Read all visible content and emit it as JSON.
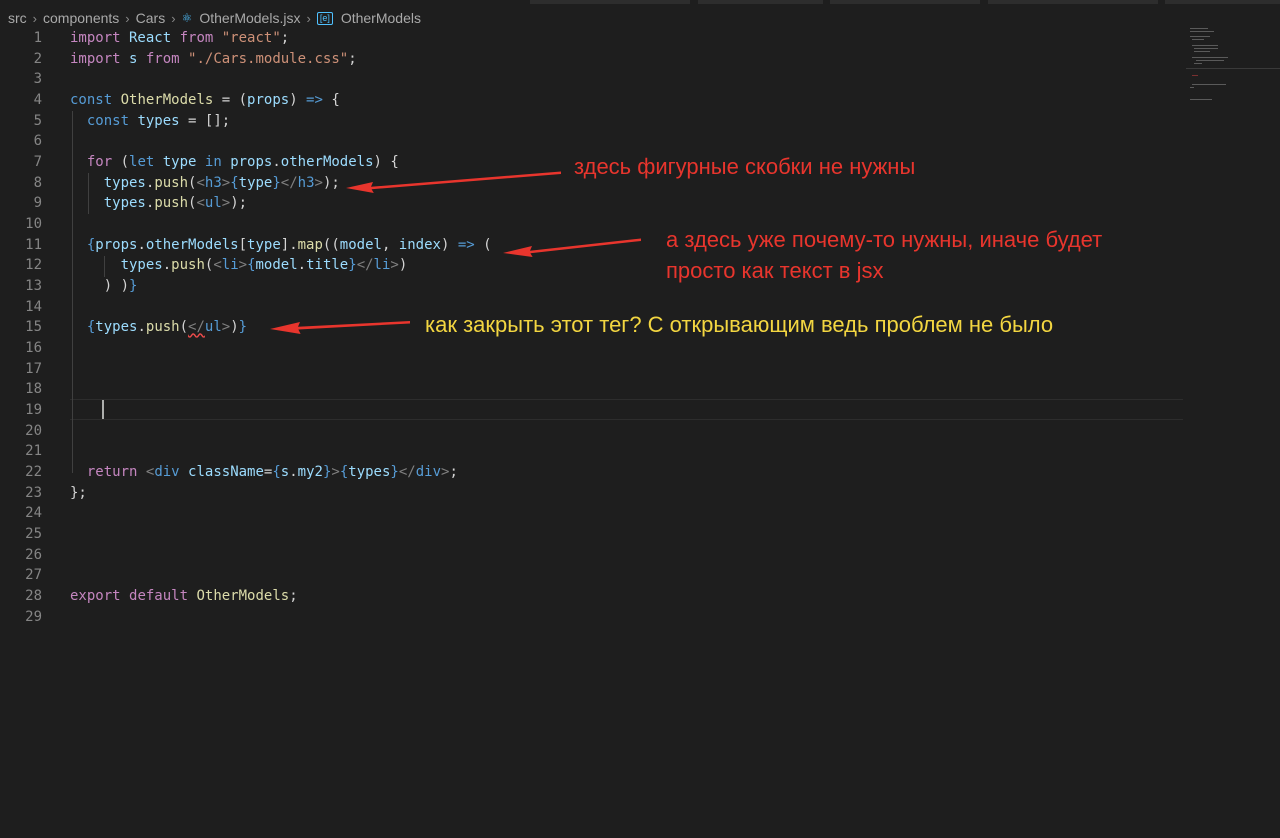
{
  "breadcrumb": {
    "items": [
      "src",
      "components",
      "Cars"
    ],
    "file": "OtherModels.jsx",
    "symbol": "OtherModels"
  },
  "editor": {
    "line_numbers": [
      "1",
      "2",
      "3",
      "4",
      "5",
      "6",
      "7",
      "8",
      "9",
      "10",
      "11",
      "12",
      "13",
      "14",
      "15",
      "16",
      "17",
      "18",
      "19",
      "20",
      "21",
      "22",
      "23",
      "24",
      "25",
      "26",
      "27",
      "28",
      "29"
    ],
    "lines": [
      [
        [
          "import",
          "ctl"
        ],
        [
          " React ",
          "var"
        ],
        [
          "from",
          "ctl"
        ],
        [
          " ",
          "pun"
        ],
        [
          "\"react\"",
          "str"
        ],
        [
          ";",
          "pun"
        ]
      ],
      [
        [
          "import",
          "ctl"
        ],
        [
          " s ",
          "var"
        ],
        [
          "from",
          "ctl"
        ],
        [
          " ",
          "pun"
        ],
        [
          "\"./Cars.module.css\"",
          "str"
        ],
        [
          ";",
          "pun"
        ]
      ],
      [],
      [
        [
          "const",
          "kw"
        ],
        [
          " ",
          "pun"
        ],
        [
          "OtherModels",
          "fn"
        ],
        [
          " = (",
          "pun"
        ],
        [
          "props",
          "var"
        ],
        [
          ") ",
          "pun"
        ],
        [
          "=>",
          "kw"
        ],
        [
          " {",
          "pun"
        ]
      ],
      [
        [
          "  ",
          "pun"
        ],
        [
          "const",
          "kw"
        ],
        [
          " ",
          "pun"
        ],
        [
          "types",
          "var"
        ],
        [
          " = [];",
          "pun"
        ]
      ],
      [],
      [
        [
          "  ",
          "pun"
        ],
        [
          "for",
          "ctl"
        ],
        [
          " (",
          "pun"
        ],
        [
          "let",
          "kw"
        ],
        [
          " ",
          "pun"
        ],
        [
          "type",
          "var"
        ],
        [
          " ",
          "pun"
        ],
        [
          "in",
          "kw"
        ],
        [
          " ",
          "pun"
        ],
        [
          "props",
          "var"
        ],
        [
          ".",
          "pun"
        ],
        [
          "otherModels",
          "var"
        ],
        [
          ") {",
          "pun"
        ]
      ],
      [
        [
          "    ",
          "pun"
        ],
        [
          "types",
          "var"
        ],
        [
          ".",
          "pun"
        ],
        [
          "push",
          "fn"
        ],
        [
          "(",
          "pun"
        ],
        [
          "<",
          "brk"
        ],
        [
          "h3",
          "tag"
        ],
        [
          ">",
          "brk"
        ],
        [
          "{",
          "kw"
        ],
        [
          "type",
          "var"
        ],
        [
          "}",
          "kw"
        ],
        [
          "</",
          "brk"
        ],
        [
          "h3",
          "tag"
        ],
        [
          ">",
          "brk"
        ],
        [
          ");",
          "pun"
        ]
      ],
      [
        [
          "    ",
          "pun"
        ],
        [
          "types",
          "var"
        ],
        [
          ".",
          "pun"
        ],
        [
          "push",
          "fn"
        ],
        [
          "(",
          "pun"
        ],
        [
          "<",
          "brk"
        ],
        [
          "ul",
          "tag"
        ],
        [
          ">",
          "brk"
        ],
        [
          ");",
          "pun"
        ]
      ],
      [],
      [
        [
          "  ",
          "pun"
        ],
        [
          "{",
          "kw"
        ],
        [
          "props",
          "var"
        ],
        [
          ".",
          "pun"
        ],
        [
          "otherModels",
          "var"
        ],
        [
          "[",
          "pun"
        ],
        [
          "type",
          "var"
        ],
        [
          "].",
          "pun"
        ],
        [
          "map",
          "fn"
        ],
        [
          "((",
          "pun"
        ],
        [
          "model",
          "var"
        ],
        [
          ", ",
          "pun"
        ],
        [
          "index",
          "var"
        ],
        [
          ") ",
          "pun"
        ],
        [
          "=>",
          "kw"
        ],
        [
          " (",
          "pun"
        ]
      ],
      [
        [
          "      ",
          "pun"
        ],
        [
          "types",
          "var"
        ],
        [
          ".",
          "pun"
        ],
        [
          "push",
          "fn"
        ],
        [
          "(",
          "pun"
        ],
        [
          "<",
          "brk"
        ],
        [
          "li",
          "tag"
        ],
        [
          ">",
          "brk"
        ],
        [
          "{",
          "kw"
        ],
        [
          "model",
          "var"
        ],
        [
          ".",
          "pun"
        ],
        [
          "title",
          "var"
        ],
        [
          "}",
          "kw"
        ],
        [
          "</",
          "brk"
        ],
        [
          "li",
          "tag"
        ],
        [
          ">",
          "brk"
        ],
        [
          ")",
          "pun"
        ]
      ],
      [
        [
          "    ",
          "pun"
        ],
        [
          ") )",
          "pun"
        ],
        [
          "}",
          "kw"
        ]
      ],
      [],
      [
        [
          "  ",
          "pun"
        ],
        [
          "{",
          "kw"
        ],
        [
          "types",
          "var"
        ],
        [
          ".",
          "pun"
        ],
        [
          "push",
          "fn"
        ],
        [
          "(",
          "pun"
        ],
        [
          "</",
          "brk squiggle"
        ],
        [
          "ul",
          "tag"
        ],
        [
          ">",
          "brk"
        ],
        [
          ")",
          "pun"
        ],
        [
          "}",
          "kw"
        ]
      ],
      [],
      [],
      [],
      [],
      [],
      [],
      [
        [
          "  ",
          "pun"
        ],
        [
          "return",
          "ctl"
        ],
        [
          " ",
          "pun"
        ],
        [
          "<",
          "brk"
        ],
        [
          "div",
          "tag"
        ],
        [
          " ",
          "pun"
        ],
        [
          "className",
          "var"
        ],
        [
          "=",
          "pun"
        ],
        [
          "{",
          "kw"
        ],
        [
          "s",
          "var"
        ],
        [
          ".",
          "pun"
        ],
        [
          "my2",
          "var"
        ],
        [
          "}",
          "kw"
        ],
        [
          ">",
          "brk"
        ],
        [
          "{",
          "kw"
        ],
        [
          "types",
          "var"
        ],
        [
          "}",
          "kw"
        ],
        [
          "</",
          "brk"
        ],
        [
          "div",
          "tag"
        ],
        [
          ">",
          "brk"
        ],
        [
          ";",
          "pun"
        ]
      ],
      [
        [
          "};",
          "pun"
        ]
      ],
      [],
      [],
      [],
      [],
      [
        [
          "export",
          "ctl"
        ],
        [
          " ",
          "pun"
        ],
        [
          "default",
          "ctl"
        ],
        [
          " ",
          "pun"
        ],
        [
          "OtherModels",
          "fn"
        ],
        [
          ";",
          "pun"
        ]
      ],
      []
    ]
  },
  "annotations": {
    "a1": "здесь фигурные скобки не нужны",
    "a2_line1": "а здесь уже почему-то нужны, иначе будет",
    "a2_line2": "просто как текст в jsx",
    "a3": "как закрыть этот тег? С открывающим ведь проблем не было"
  },
  "colors": {
    "background": "#1e1e1e",
    "annotation_red": "#e8352d",
    "annotation_yellow": "#f3d641"
  }
}
